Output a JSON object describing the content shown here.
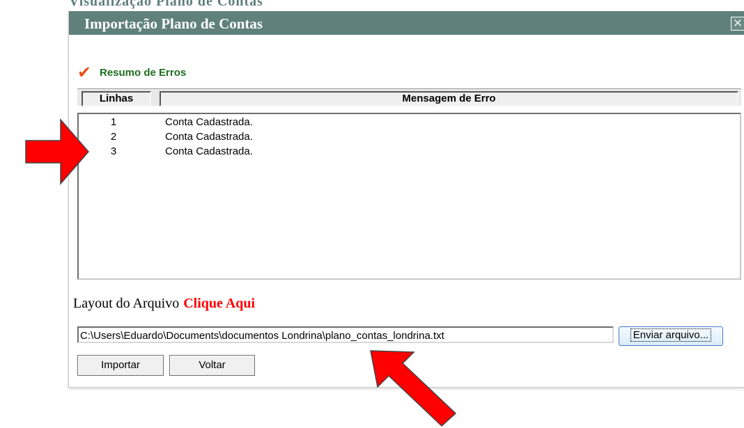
{
  "background_window": {
    "title_fragment": "Visualização Plano de Contas"
  },
  "dialog": {
    "title": "Importação Plano de Contas",
    "close_icon": "×"
  },
  "summary": {
    "label": "Resumo de Erros",
    "icon": "checkmark-icon"
  },
  "table": {
    "columns": [
      "Linhas",
      "Mensagem de Erro"
    ],
    "rows": [
      {
        "line": "1",
        "message": "Conta Cadastrada."
      },
      {
        "line": "2",
        "message": "Conta Cadastrada."
      },
      {
        "line": "3",
        "message": "Conta Cadastrada."
      }
    ]
  },
  "layout": {
    "prefix": "Layout do Arquivo",
    "link": "Clique Aqui"
  },
  "file": {
    "value": "C:\\Users\\Eduardo\\Documents\\documentos Londrina\\plano_contas_londrina.txt",
    "send_label": "Enviar arquivo..."
  },
  "buttons": {
    "import": "Importar",
    "back": "Voltar"
  },
  "annotations": {
    "arrow_color": "#ff0000"
  }
}
